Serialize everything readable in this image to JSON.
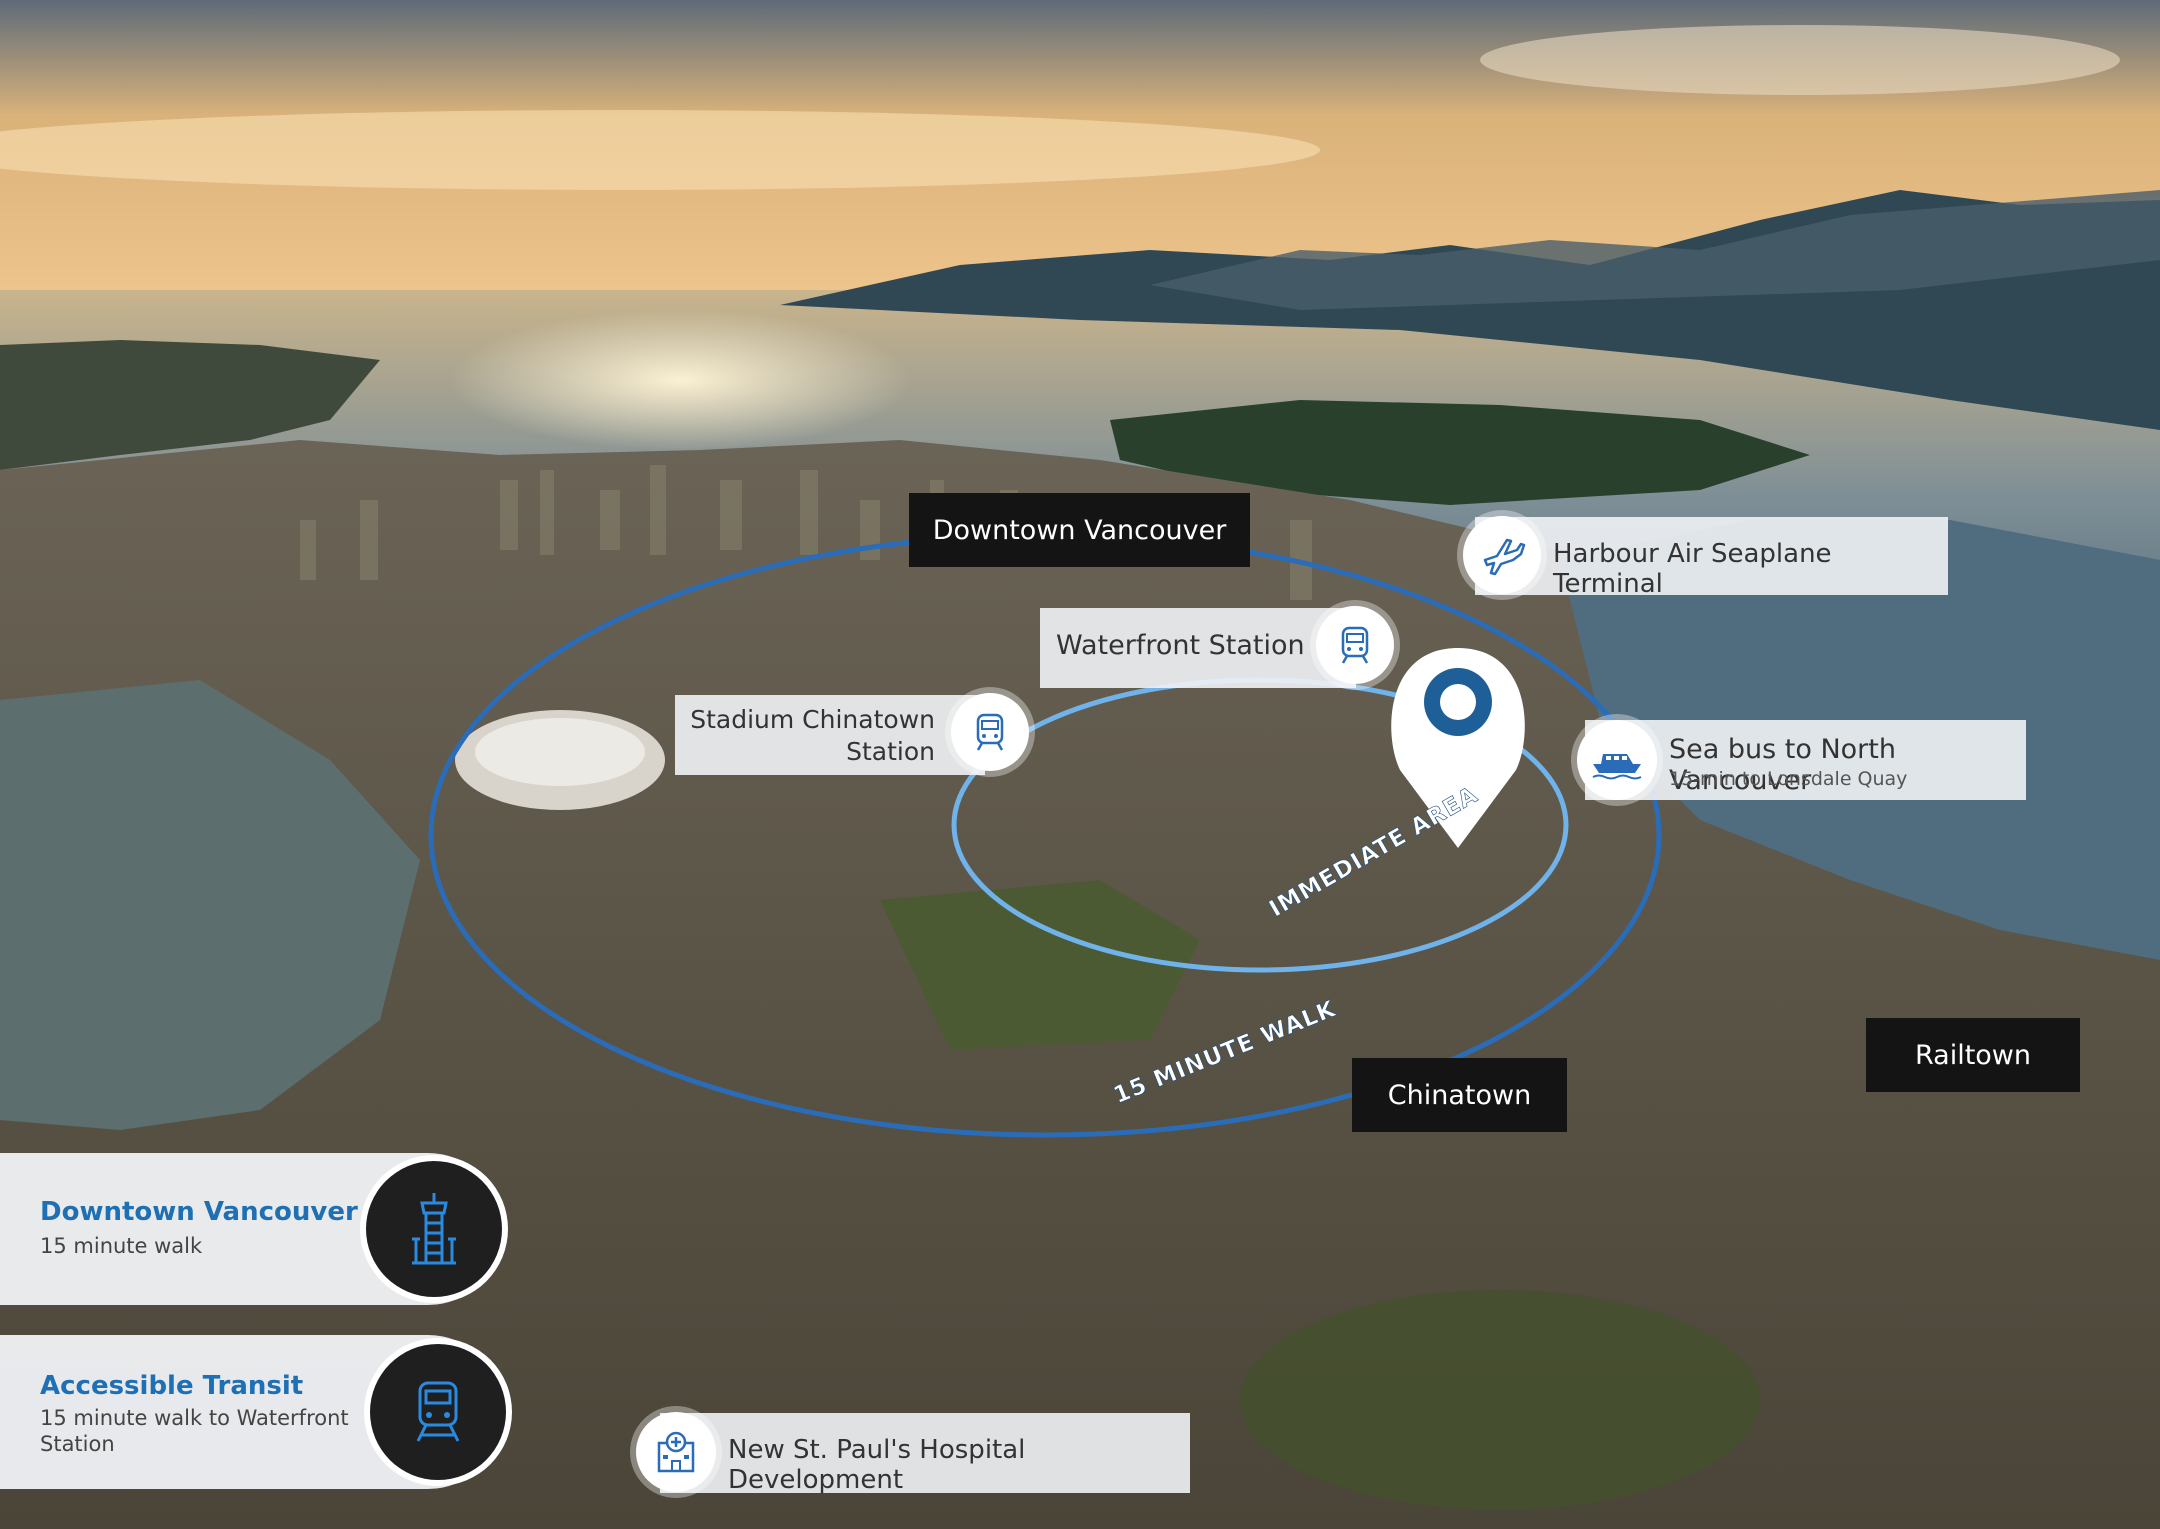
{
  "map_labels": {
    "downtown": "Downtown Vancouver",
    "chinatown": "Chinatown",
    "railtown": "Railtown",
    "immediate_area": "IMMEDIATE AREA",
    "fifteen_min_walk": "15 MINUTE WALK"
  },
  "points": {
    "seaplane": {
      "label": "Harbour Air Seaplane Terminal",
      "icon": "airplane-icon"
    },
    "waterfront": {
      "label": "Waterfront Station",
      "icon": "train-icon"
    },
    "stadium": {
      "line1": "Stadium Chinatown",
      "line2": "Station",
      "icon": "train-icon"
    },
    "seabus": {
      "label": "Sea bus to North Vancouver",
      "sub": "15-min to Lonsdale Quay",
      "icon": "ferry-icon"
    },
    "hospital": {
      "label": "New St. Paul's Hospital Development",
      "icon": "hospital-icon"
    }
  },
  "cards": {
    "downtown": {
      "title": "Downtown Vancouver",
      "sub": "15 minute walk",
      "icon": "tower-icon"
    },
    "transit": {
      "title": "Accessible Transit",
      "sub_line1": "15 minute walk to Waterfront",
      "sub_line2": "Station",
      "icon": "train-icon"
    }
  },
  "colors": {
    "accent": "#1e6fb3",
    "ring": "#2a6cb8",
    "ring_inner": "#6fb3ea",
    "pin": "#ffffff",
    "label_dark": "#141414"
  }
}
